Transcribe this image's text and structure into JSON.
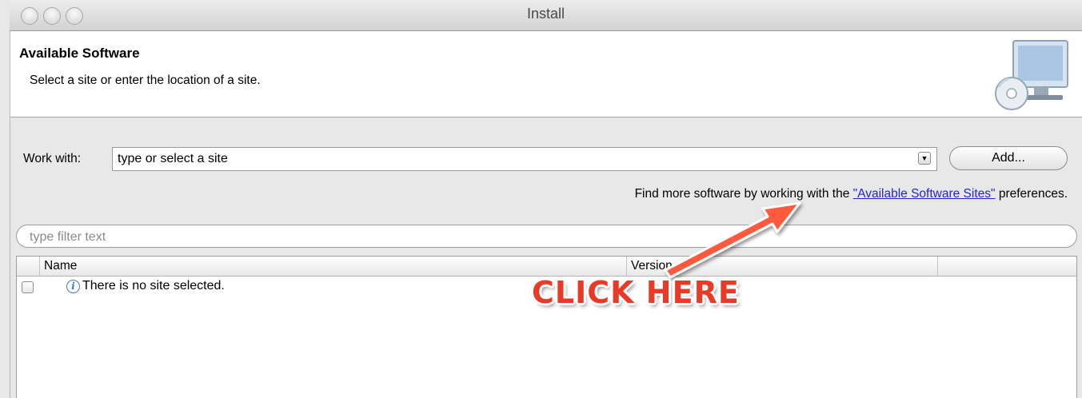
{
  "window": {
    "title": "Install"
  },
  "header": {
    "title": "Available Software",
    "description": "Select a site or enter the location of a site."
  },
  "work_with": {
    "label": "Work with:",
    "value": "type or select a site",
    "add_label": "Add..."
  },
  "find_more": {
    "prefix": "Find more software by working with the ",
    "link": "\"Available Software Sites\"",
    "suffix": " preferences."
  },
  "filter": {
    "placeholder": "type filter text"
  },
  "table": {
    "columns": [
      "Name",
      "Version"
    ],
    "rows": [
      {
        "text": "There is no site selected."
      }
    ]
  },
  "annotation": {
    "text": "CLICK HERE",
    "color": "#e83a26"
  },
  "icons": [
    "info-icon",
    "computer-cd-icon",
    "dropdown-arrow-icon"
  ]
}
